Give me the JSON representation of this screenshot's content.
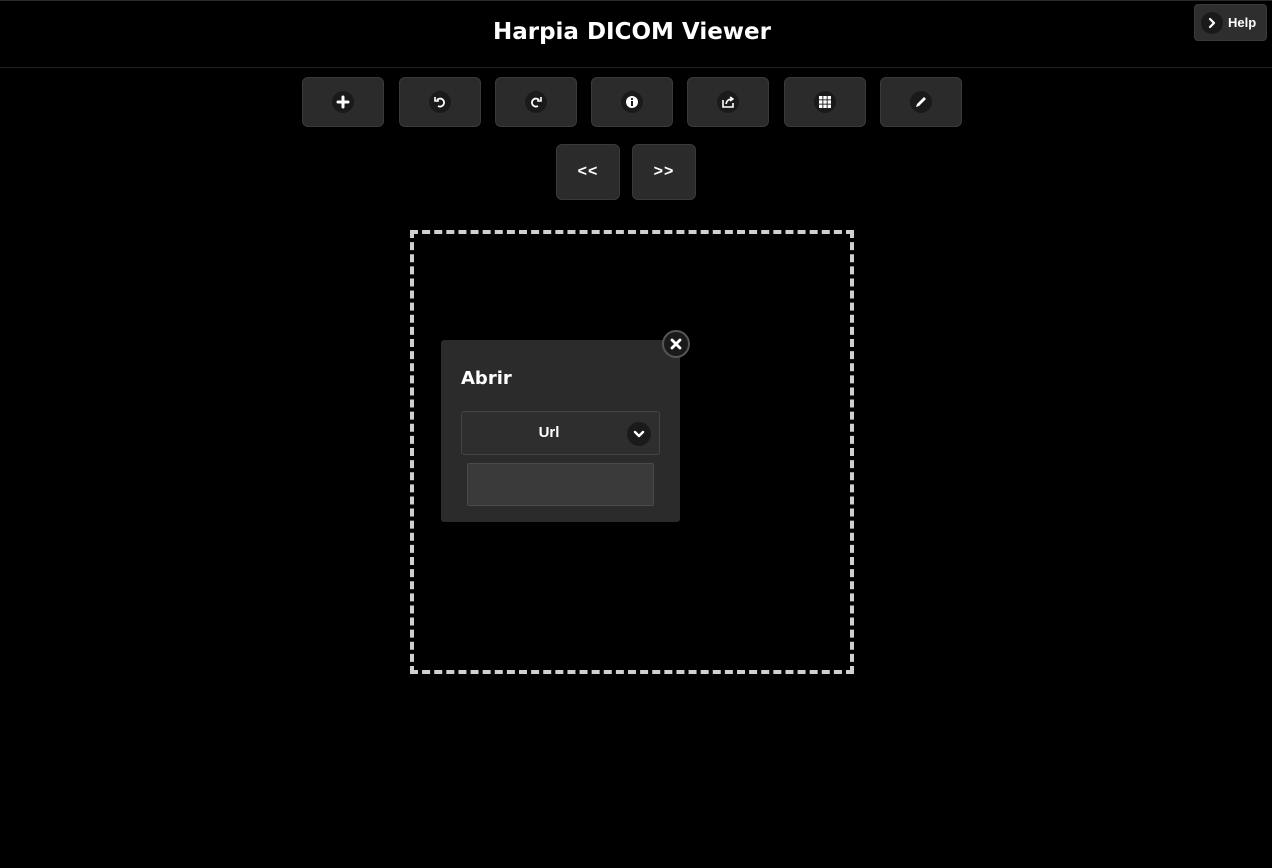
{
  "header": {
    "title": "Harpia DICOM Viewer"
  },
  "help": {
    "label": "Help",
    "icon": "chevron-right-icon"
  },
  "toolbar": {
    "buttons": [
      {
        "name": "add",
        "icon": "plus-icon"
      },
      {
        "name": "undo",
        "icon": "undo-icon"
      },
      {
        "name": "redo",
        "icon": "redo-icon"
      },
      {
        "name": "info",
        "icon": "info-icon"
      },
      {
        "name": "share",
        "icon": "share-icon"
      },
      {
        "name": "grid",
        "icon": "grid-icon"
      },
      {
        "name": "edit",
        "icon": "pencil-icon"
      }
    ]
  },
  "nav": {
    "prev_label": "<<",
    "next_label": ">>"
  },
  "dialog": {
    "title": "Abrir",
    "select": {
      "selected": "Url",
      "icon": "chevron-down-icon"
    },
    "input": {
      "value": "",
      "placeholder": ""
    },
    "close_icon": "close-icon"
  },
  "colors": {
    "background": "#000000",
    "button": "#2b2b2b",
    "dropzone_border": "#d0d0d0"
  }
}
